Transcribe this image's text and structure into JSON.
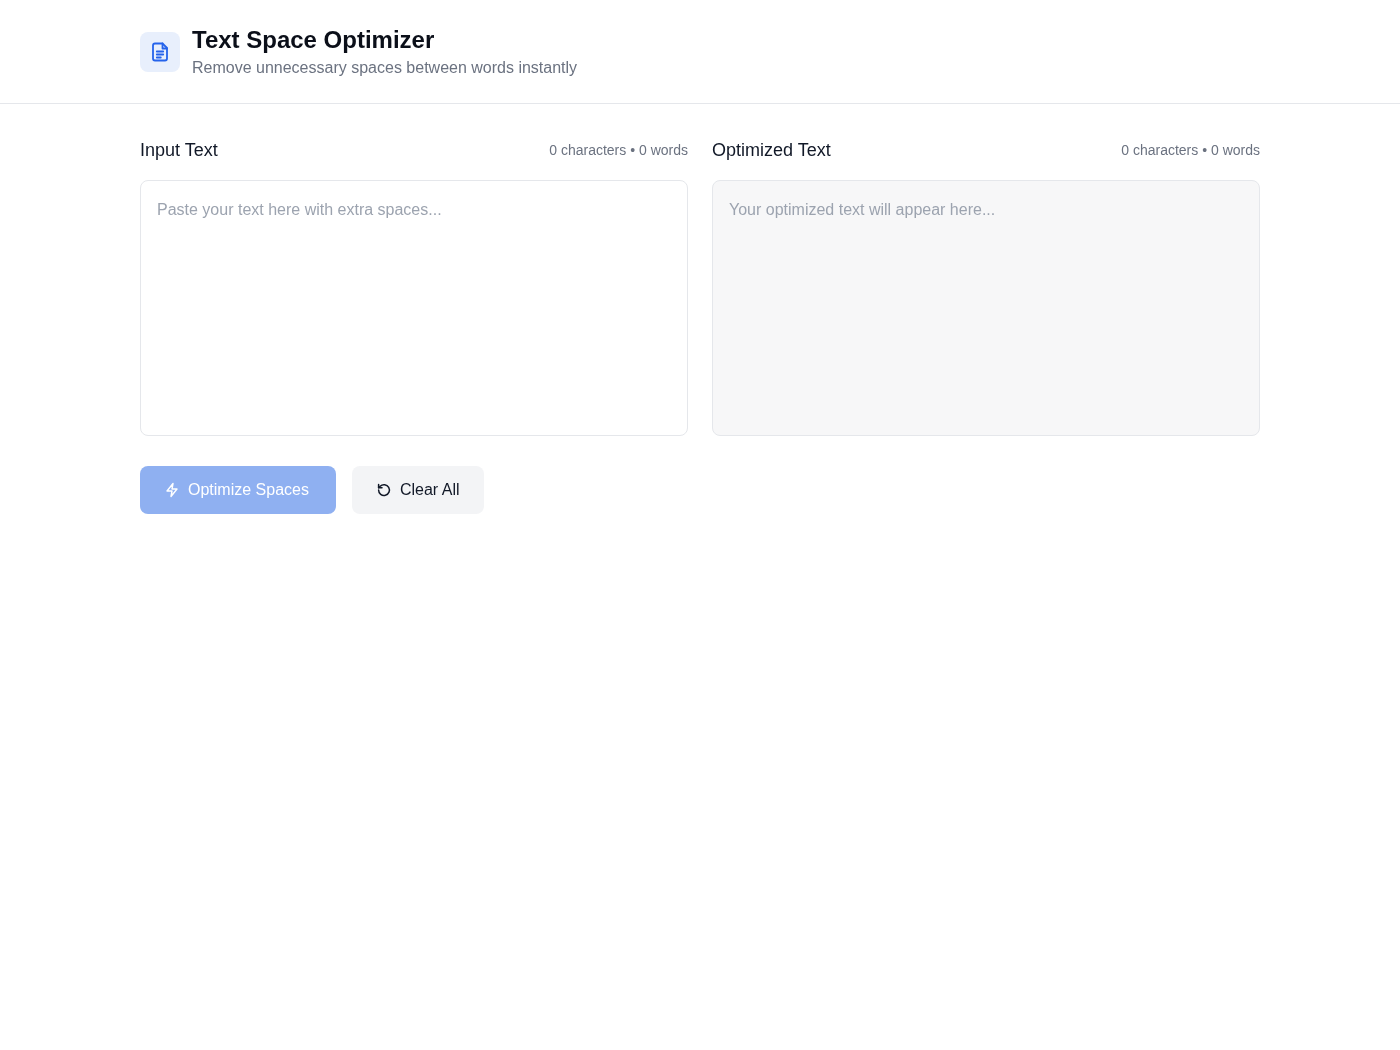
{
  "header": {
    "title": "Text Space Optimizer",
    "subtitle": "Remove unnecessary spaces between words instantly"
  },
  "panels": [
    {
      "kind": "input",
      "label": "Input Text",
      "counts": "0 characters • 0 words",
      "placeholder": "Paste your text here with extra spaces..."
    },
    {
      "kind": "output",
      "label": "Optimized Text",
      "counts": "0 characters • 0 words",
      "placeholder": "Your optimized text will appear here..."
    }
  ],
  "actions": [
    {
      "kind": "optimize",
      "label": "Optimize Spaces",
      "disabled": true
    },
    {
      "kind": "clear",
      "label": "Clear All",
      "disabled": false
    }
  ]
}
